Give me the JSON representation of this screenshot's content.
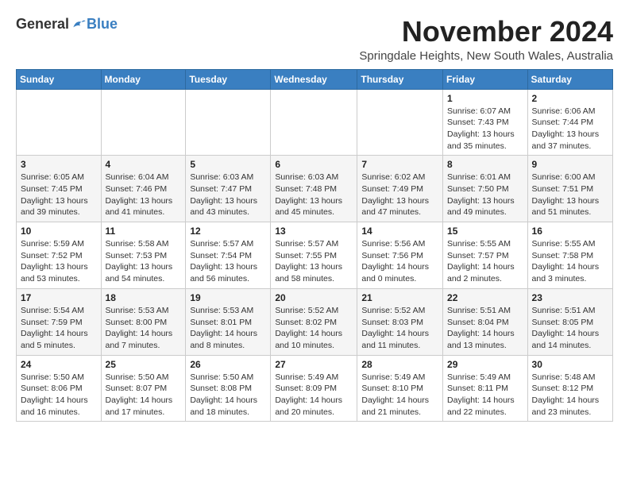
{
  "header": {
    "logo_general": "General",
    "logo_blue": "Blue",
    "month_title": "November 2024",
    "location": "Springdale Heights, New South Wales, Australia"
  },
  "calendar": {
    "days_of_week": [
      "Sunday",
      "Monday",
      "Tuesday",
      "Wednesday",
      "Thursday",
      "Friday",
      "Saturday"
    ],
    "weeks": [
      [
        {
          "day": "",
          "info": ""
        },
        {
          "day": "",
          "info": ""
        },
        {
          "day": "",
          "info": ""
        },
        {
          "day": "",
          "info": ""
        },
        {
          "day": "",
          "info": ""
        },
        {
          "day": "1",
          "info": "Sunrise: 6:07 AM\nSunset: 7:43 PM\nDaylight: 13 hours\nand 35 minutes."
        },
        {
          "day": "2",
          "info": "Sunrise: 6:06 AM\nSunset: 7:44 PM\nDaylight: 13 hours\nand 37 minutes."
        }
      ],
      [
        {
          "day": "3",
          "info": "Sunrise: 6:05 AM\nSunset: 7:45 PM\nDaylight: 13 hours\nand 39 minutes."
        },
        {
          "day": "4",
          "info": "Sunrise: 6:04 AM\nSunset: 7:46 PM\nDaylight: 13 hours\nand 41 minutes."
        },
        {
          "day": "5",
          "info": "Sunrise: 6:03 AM\nSunset: 7:47 PM\nDaylight: 13 hours\nand 43 minutes."
        },
        {
          "day": "6",
          "info": "Sunrise: 6:03 AM\nSunset: 7:48 PM\nDaylight: 13 hours\nand 45 minutes."
        },
        {
          "day": "7",
          "info": "Sunrise: 6:02 AM\nSunset: 7:49 PM\nDaylight: 13 hours\nand 47 minutes."
        },
        {
          "day": "8",
          "info": "Sunrise: 6:01 AM\nSunset: 7:50 PM\nDaylight: 13 hours\nand 49 minutes."
        },
        {
          "day": "9",
          "info": "Sunrise: 6:00 AM\nSunset: 7:51 PM\nDaylight: 13 hours\nand 51 minutes."
        }
      ],
      [
        {
          "day": "10",
          "info": "Sunrise: 5:59 AM\nSunset: 7:52 PM\nDaylight: 13 hours\nand 53 minutes."
        },
        {
          "day": "11",
          "info": "Sunrise: 5:58 AM\nSunset: 7:53 PM\nDaylight: 13 hours\nand 54 minutes."
        },
        {
          "day": "12",
          "info": "Sunrise: 5:57 AM\nSunset: 7:54 PM\nDaylight: 13 hours\nand 56 minutes."
        },
        {
          "day": "13",
          "info": "Sunrise: 5:57 AM\nSunset: 7:55 PM\nDaylight: 13 hours\nand 58 minutes."
        },
        {
          "day": "14",
          "info": "Sunrise: 5:56 AM\nSunset: 7:56 PM\nDaylight: 14 hours\nand 0 minutes."
        },
        {
          "day": "15",
          "info": "Sunrise: 5:55 AM\nSunset: 7:57 PM\nDaylight: 14 hours\nand 2 minutes."
        },
        {
          "day": "16",
          "info": "Sunrise: 5:55 AM\nSunset: 7:58 PM\nDaylight: 14 hours\nand 3 minutes."
        }
      ],
      [
        {
          "day": "17",
          "info": "Sunrise: 5:54 AM\nSunset: 7:59 PM\nDaylight: 14 hours\nand 5 minutes."
        },
        {
          "day": "18",
          "info": "Sunrise: 5:53 AM\nSunset: 8:00 PM\nDaylight: 14 hours\nand 7 minutes."
        },
        {
          "day": "19",
          "info": "Sunrise: 5:53 AM\nSunset: 8:01 PM\nDaylight: 14 hours\nand 8 minutes."
        },
        {
          "day": "20",
          "info": "Sunrise: 5:52 AM\nSunset: 8:02 PM\nDaylight: 14 hours\nand 10 minutes."
        },
        {
          "day": "21",
          "info": "Sunrise: 5:52 AM\nSunset: 8:03 PM\nDaylight: 14 hours\nand 11 minutes."
        },
        {
          "day": "22",
          "info": "Sunrise: 5:51 AM\nSunset: 8:04 PM\nDaylight: 14 hours\nand 13 minutes."
        },
        {
          "day": "23",
          "info": "Sunrise: 5:51 AM\nSunset: 8:05 PM\nDaylight: 14 hours\nand 14 minutes."
        }
      ],
      [
        {
          "day": "24",
          "info": "Sunrise: 5:50 AM\nSunset: 8:06 PM\nDaylight: 14 hours\nand 16 minutes."
        },
        {
          "day": "25",
          "info": "Sunrise: 5:50 AM\nSunset: 8:07 PM\nDaylight: 14 hours\nand 17 minutes."
        },
        {
          "day": "26",
          "info": "Sunrise: 5:50 AM\nSunset: 8:08 PM\nDaylight: 14 hours\nand 18 minutes."
        },
        {
          "day": "27",
          "info": "Sunrise: 5:49 AM\nSunset: 8:09 PM\nDaylight: 14 hours\nand 20 minutes."
        },
        {
          "day": "28",
          "info": "Sunrise: 5:49 AM\nSunset: 8:10 PM\nDaylight: 14 hours\nand 21 minutes."
        },
        {
          "day": "29",
          "info": "Sunrise: 5:49 AM\nSunset: 8:11 PM\nDaylight: 14 hours\nand 22 minutes."
        },
        {
          "day": "30",
          "info": "Sunrise: 5:48 AM\nSunset: 8:12 PM\nDaylight: 14 hours\nand 23 minutes."
        }
      ]
    ]
  }
}
